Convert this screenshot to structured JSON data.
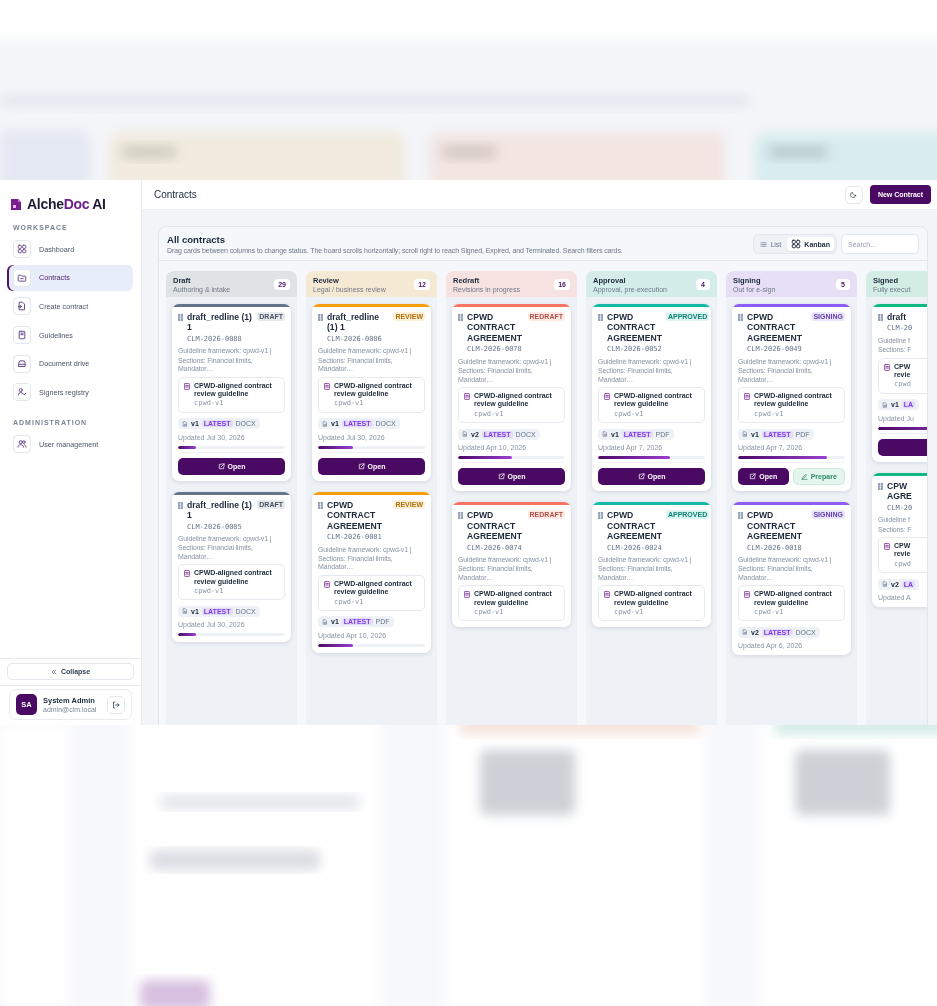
{
  "logo": {
    "parts": [
      {
        "text": "Alche",
        "accent": false
      },
      {
        "text": "Doc",
        "accent": true
      },
      {
        "text": " AI",
        "accent": false
      }
    ]
  },
  "sidebar": {
    "sections": [
      {
        "title": "WORKSPACE",
        "items": [
          {
            "label": "Dashboard",
            "selected": false
          },
          {
            "label": "Contracts",
            "selected": true
          },
          {
            "label": "Create contract",
            "selected": false
          },
          {
            "label": "Guidelines",
            "selected": false
          },
          {
            "label": "Document drive",
            "selected": false
          },
          {
            "label": "Signers registry",
            "selected": false
          }
        ]
      },
      {
        "title": "ADMINISTRATION",
        "items": [
          {
            "label": "User management",
            "selected": false
          }
        ]
      }
    ],
    "collapse": "Collapse"
  },
  "user": {
    "initials": "SA",
    "name": "System Admin",
    "email": "admin@clm.local"
  },
  "header": {
    "title": "Contracts",
    "new_button": "New Contract"
  },
  "board": {
    "title": "All contracts",
    "description": "Drag cards between columns to change status. The board scrolls horizontally; scroll right to reach Signed, Expired, and Terminated. Search filters cards.",
    "views": [
      {
        "label": "List",
        "selected": false
      },
      {
        "label": "Kanban",
        "selected": true
      }
    ],
    "search": {
      "placeholder": "Search..."
    }
  },
  "columns": [
    {
      "title": "Draft",
      "subtitle": "Authoring & intake",
      "count": "29",
      "color": "#64748b",
      "cards": [
        {
          "title": "draft_redline (1) 1",
          "badge": "DRAFT",
          "code": "CLM-2026-0088",
          "framework": "Guideline framework: cpwd-v1 |",
          "sections": "Sections: Financial limits, Mandator…",
          "guideline": "CPWD-aligned contract review guideline",
          "guideline_code": "cpwd-v1",
          "version": "v1",
          "latest": "LATEST",
          "format": "DOCX",
          "updated": "Updated Jul 30, 2026",
          "level": 0.17,
          "actions": [
            {
              "kind": "primary",
              "label": "Open"
            }
          ]
        },
        {
          "title": "draft_redline (1) 1",
          "badge": "DRAFT",
          "code": "CLM-2026-0085",
          "framework": "Guideline framework: cpwd-v1 |",
          "sections": "Sections: Financial limits, Mandator…",
          "guideline": "CPWD-aligned contract review guideline",
          "guideline_code": "cpwd-v1",
          "version": "v1",
          "latest": "LATEST",
          "format": "DOCX",
          "updated": "Updated Jul 30, 2026",
          "level": 0.17
        }
      ]
    },
    {
      "title": "Review",
      "subtitle": "Legal / business review",
      "count": "12",
      "color": "#f59e0b",
      "cards": [
        {
          "title": "draft_redline (1) 1",
          "badge": "REVIEW",
          "code": "CLM-2026-0086",
          "framework": "Guideline framework: cpwd-v1 |",
          "sections": "Sections: Financial limits, Mandator…",
          "guideline": "CPWD-aligned contract review guideline",
          "guideline_code": "cpwd-v1",
          "version": "v1",
          "latest": "LATEST",
          "format": "DOCX",
          "updated": "Updated Jul 30, 2026",
          "level": 0.33,
          "actions": [
            {
              "kind": "primary",
              "label": "Open"
            }
          ]
        },
        {
          "title": "CPWD CONTRACT AGREEMENT",
          "badge": "REVIEW",
          "code": "CLM-2026-0081",
          "framework": "Guideline framework: cpwd-v1 |",
          "sections": "Sections: Financial limits, Mandator…",
          "guideline": "CPWD-aligned contract review guideline",
          "guideline_code": "cpwd-v1",
          "version": "v1",
          "latest": "LATEST",
          "format": "PDF",
          "updated": "Updated Apr 10, 2026",
          "level": 0.33
        }
      ]
    },
    {
      "title": "Redraft",
      "subtitle": "Revisions in progress",
      "count": "16",
      "color": "#f97362",
      "cards": [
        {
          "title": "CPWD CONTRACT AGREEMENT",
          "badge": "REDRAFT",
          "code": "CLM-2026-0078",
          "framework": "Guideline framework: cpwd-v1 |",
          "sections": "Sections: Financial limits, Mandator…",
          "guideline": "CPWD-aligned contract review guideline",
          "guideline_code": "cpwd-v1",
          "version": "v2",
          "latest": "LATEST",
          "format": "DOCX",
          "updated": "Updated Apr 10, 2026",
          "level": 0.5,
          "actions": [
            {
              "kind": "primary",
              "label": "Open"
            }
          ]
        },
        {
          "title": "CPWD CONTRACT AGREEMENT",
          "badge": "REDRAFT",
          "code": "CLM-2026-0074",
          "framework": "Guideline framework: cpwd-v1 |",
          "sections": "Sections: Financial limits, Mandator…",
          "guideline": "CPWD-aligned contract review guideline",
          "guideline_code": "cpwd-v1"
        }
      ]
    },
    {
      "title": "Approval",
      "subtitle": "Approval, pre-execution",
      "count": "4",
      "color": "#14b8a6",
      "cards": [
        {
          "title": "CPWD CONTRACT AGREEMENT",
          "badge": "APPROVED",
          "code": "CLM-2026-0052",
          "framework": "Guideline framework: cpwd-v1 |",
          "sections": "Sections: Financial limits, Mandator…",
          "guideline": "CPWD-aligned contract review guideline",
          "guideline_code": "cpwd-v1",
          "version": "v1",
          "latest": "LATEST",
          "format": "PDF",
          "updated": "Updated Apr 7, 2026",
          "level": 0.67,
          "actions": [
            {
              "kind": "primary",
              "label": "Open"
            }
          ]
        },
        {
          "title": "CPWD CONTRACT AGREEMENT",
          "badge": "APPROVED",
          "code": "CLM-2026-0024",
          "framework": "Guideline framework: cpwd-v1 |",
          "sections": "Sections: Financial limits, Mandator…",
          "guideline": "CPWD-aligned contract review guideline",
          "guideline_code": "cpwd-v1"
        }
      ]
    },
    {
      "title": "Signing",
      "subtitle": "Out for e-sign",
      "count": "5",
      "color": "#8b5cf6",
      "cards": [
        {
          "title": "CPWD CONTRACT AGREEMENT",
          "badge": "SIGNING",
          "code": "CLM-2026-0049",
          "framework": "Guideline framework: cpwd-v1 |",
          "sections": "Sections: Financial limits, Mandator…",
          "guideline": "CPWD-aligned contract review guideline",
          "guideline_code": "cpwd-v1",
          "version": "v1",
          "latest": "LATEST",
          "format": "PDF",
          "updated": "Updated Apr 7, 2026",
          "level": 0.83,
          "actions": [
            {
              "kind": "primary",
              "label": "Open"
            },
            {
              "kind": "secondary",
              "label": "Prepare"
            }
          ]
        },
        {
          "title": "CPWD CONTRACT AGREEMENT",
          "badge": "SIGNING",
          "code": "CLM-2026-0018",
          "framework": "Guideline framework: cpwd-v1 |",
          "sections": "Sections: Financial limits, Mandator…",
          "guideline": "CPWD-aligned contract review guideline",
          "guideline_code": "cpwd-v1",
          "version": "v2",
          "latest": "LATEST",
          "format": "DOCX",
          "updated": "Updated Apr 6, 2026"
        }
      ]
    },
    {
      "title": "Signed",
      "subtitle": "Fully execut",
      "color": "#10b981",
      "cards": [
        {
          "title": "draft",
          "code": "CLM-20",
          "framework": "Guideline f",
          "sections": "Sections: F",
          "guideline": "CPW\nrevie",
          "guideline_code": "cpwd",
          "version": "v1",
          "latest": "LA",
          "updated": "Updated Ju",
          "level": 0.9,
          "actions": [
            {
              "kind": "primary"
            }
          ]
        },
        {
          "title": "CPW\nAGRE",
          "code": "CLM-20",
          "framework": "Guideline f",
          "sections": "Sections: F",
          "guideline": "CPW\nrevie",
          "guideline_code": "cpwd",
          "version": "v2",
          "latest": "LA",
          "updated": "Updated A"
        }
      ]
    }
  ]
}
